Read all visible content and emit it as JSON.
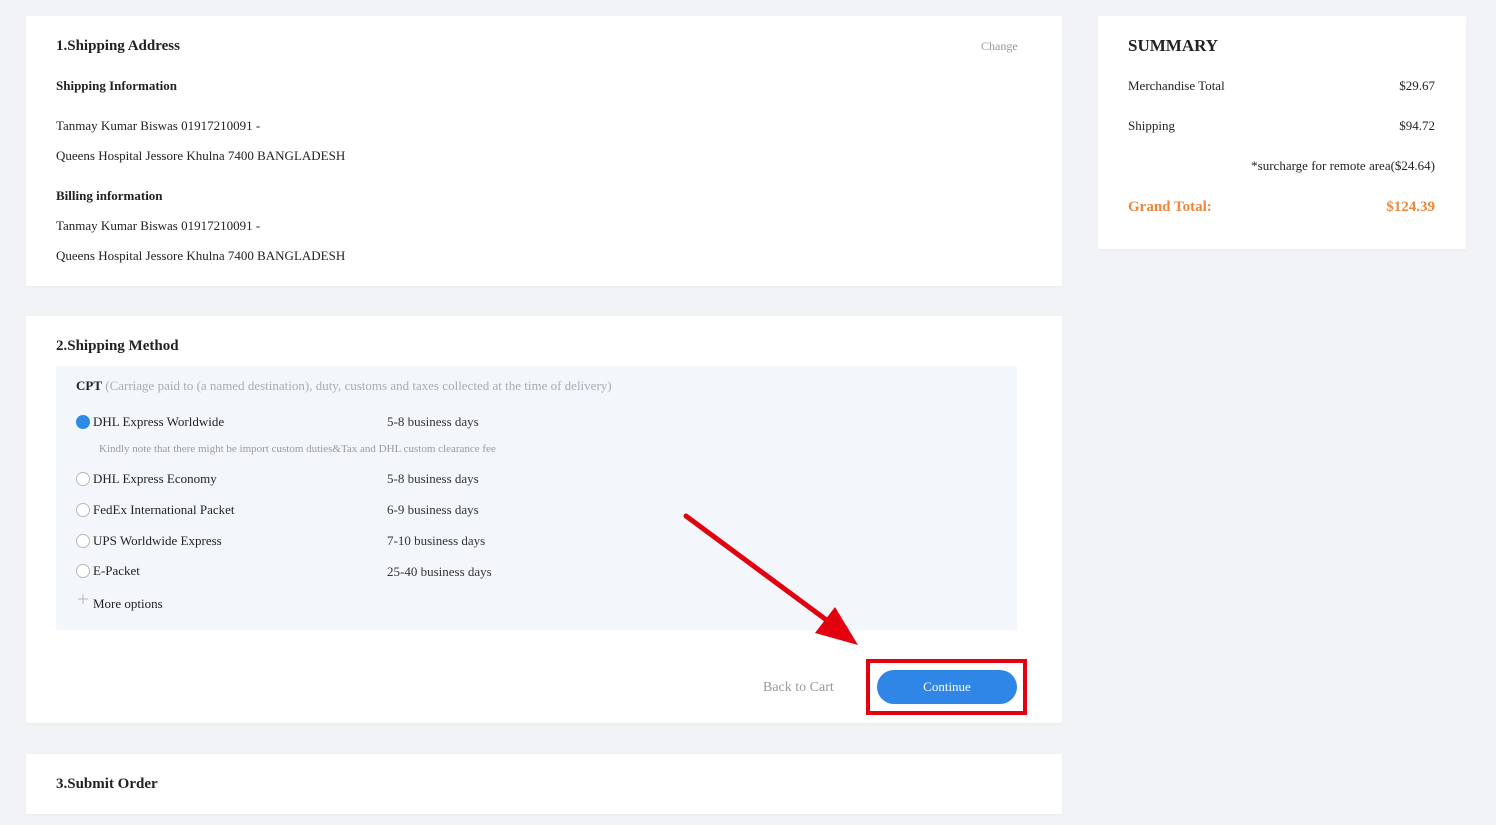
{
  "shipping_address": {
    "title": "1.Shipping Address",
    "change_link": "Change",
    "shipping_info_heading": "Shipping Information",
    "shipping_line1": "Tanmay Kumar Biswas 01917210091 -",
    "shipping_line2": "Queens Hospital Jessore Khulna 7400 BANGLADESH",
    "billing_info_heading": "Billing information",
    "billing_line1": "Tanmay Kumar Biswas 01917210091 -",
    "billing_line2": "Queens Hospital Jessore Khulna 7400 BANGLADESH"
  },
  "shipping_method": {
    "title": "2.Shipping Method",
    "terms_code": "CPT",
    "terms_desc": "(Carriage paid to (a named destination), duty, customs and taxes collected at the time of delivery)",
    "options": [
      {
        "name": "DHL Express Worldwide",
        "time": "5-8 business days",
        "selected": true
      },
      {
        "name": "DHL Express Economy",
        "time": "5-8 business days",
        "selected": false
      },
      {
        "name": "FedEx International Packet",
        "time": "6-9 business days",
        "selected": false
      },
      {
        "name": "UPS Worldwide Express",
        "time": "7-10 business days",
        "selected": false
      },
      {
        "name": "E-Packet",
        "time": "25-40 business days",
        "selected": false
      }
    ],
    "dhl_note": "Kindly note that there might be import custom duties&Tax and DHL custom clearance fee",
    "more_icon": "plus-icon",
    "more_options": "More options",
    "back_to_cart": "Back to Cart",
    "continue": "Continue"
  },
  "submit_order": {
    "title": "3.Submit Order"
  },
  "summary": {
    "title": "SUMMARY",
    "merch_label": "Merchandise Total",
    "merch_value": "$29.67",
    "shipping_label": "Shipping",
    "shipping_value": "$94.72",
    "surcharge": "*surcharge for remote area($24.64)",
    "grand_label": "Grand Total:",
    "grand_value": "$124.39"
  },
  "colors": {
    "accent": "#2f86e6",
    "grand_total": "#f0873a",
    "annotation": "#e3000f"
  }
}
